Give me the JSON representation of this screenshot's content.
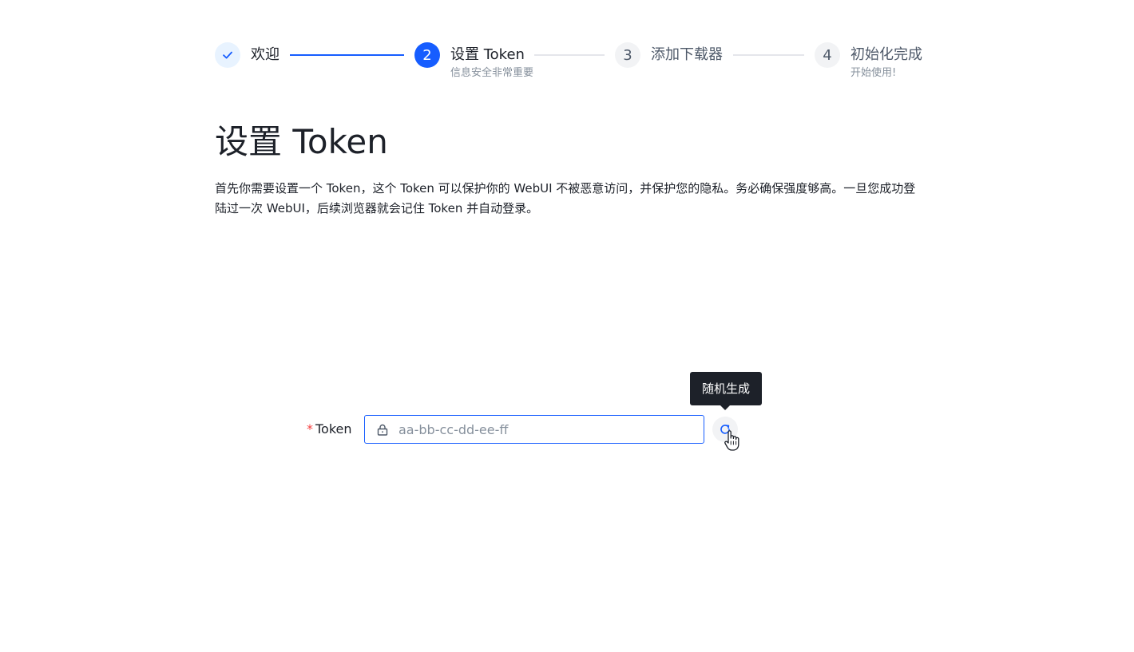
{
  "steps": [
    {
      "title": "欢迎",
      "description": "",
      "status": "done",
      "icon": "check-icon"
    },
    {
      "title": "设置 Token",
      "description": "信息安全非常重要",
      "status": "active",
      "number": "2"
    },
    {
      "title": "添加下载器",
      "description": "",
      "status": "pending",
      "number": "3"
    },
    {
      "title": "初始化完成",
      "description": "开始使用!",
      "status": "pending",
      "number": "4"
    }
  ],
  "main": {
    "title": "设置 Token",
    "description": "首先你需要设置一个 Token，这个 Token 可以保护你的 WebUI 不被恶意访问，并保护您的隐私。务必确保强度够高。一旦您成功登陆过一次 WebUI，后续浏览器就会记住 Token 并自动登录。"
  },
  "form": {
    "required_mark": "*",
    "token_label": "Token",
    "token_value": "",
    "token_placeholder": "aa-bb-cc-dd-ee-ff",
    "lock_icon": "lock-icon",
    "refresh_icon": "refresh-icon",
    "tooltip": "随机生成"
  },
  "colors": {
    "primary": "#165dff",
    "primary_light": "#e8f3ff",
    "pending_bg": "#f2f3f5",
    "text": "#1d2129",
    "muted": "#86909c",
    "required": "#f53f3f",
    "tooltip_bg": "#1d2129"
  }
}
